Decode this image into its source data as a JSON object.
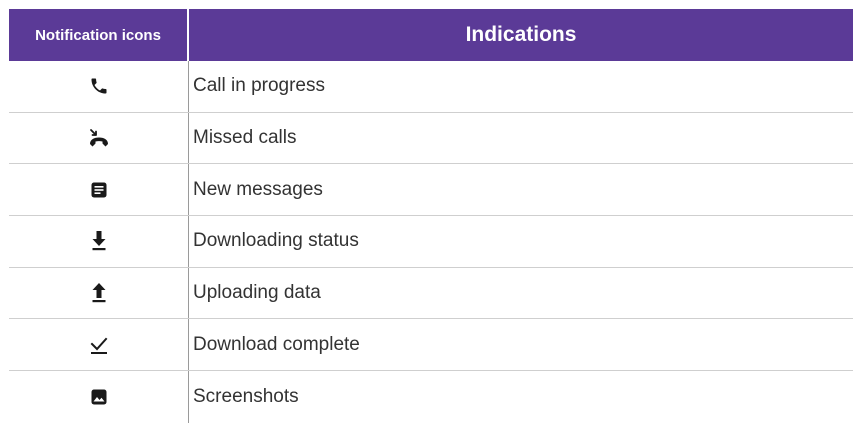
{
  "table": {
    "header": {
      "icons_col": "Notification icons",
      "indications_col": "Indications"
    },
    "rows": [
      {
        "icon": "call-in-progress-icon",
        "label": "Call in progress"
      },
      {
        "icon": "missed-calls-icon",
        "label": "Missed calls"
      },
      {
        "icon": "new-messages-icon",
        "label": "New messages"
      },
      {
        "icon": "downloading-icon",
        "label": "Downloading status"
      },
      {
        "icon": "uploading-icon",
        "label": "Uploading data"
      },
      {
        "icon": "download-complete-icon",
        "label": "Download complete"
      },
      {
        "icon": "screenshots-icon",
        "label": "Screenshots"
      }
    ]
  },
  "colors": {
    "header_bg": "#5b3a97",
    "header_text": "#ffffff",
    "icon": "#1a1a1a",
    "row_divider": "#cfcfcf"
  }
}
